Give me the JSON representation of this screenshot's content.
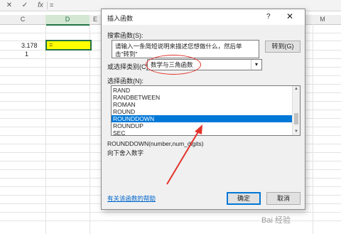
{
  "formula_bar": {
    "cancel": "✕",
    "confirm": "✓",
    "fx": "fx",
    "content": "="
  },
  "sheet": {
    "columns": [
      {
        "letter": "C",
        "selected": false
      },
      {
        "letter": "D",
        "selected": true
      },
      {
        "letter": "E",
        "selected": false
      },
      {
        "letter": "M",
        "selected": false
      }
    ],
    "cells": {
      "c_value": "3.178",
      "c_row2": "1",
      "active_cell": "="
    },
    "active_cell_color": "#ffff00",
    "accent_color": "#217346"
  },
  "dialog": {
    "title": "插入函数",
    "help_icon": "?",
    "close_icon": "✕",
    "search_label": "搜索函数(S):",
    "search_text": "请输入一条简短说明来描述您想做什么，然后单击\"转到\"",
    "goto_button": "转到(G)",
    "category_label": "或选择类别(C):",
    "category_value": "数学与三角函数",
    "function_list_label": "选择函数(N):",
    "functions": [
      "RAND",
      "RANDBETWEEN",
      "ROMAN",
      "ROUND",
      "ROUNDDOWN",
      "ROUNDUP",
      "SEC"
    ],
    "selected_function": "ROUNDDOWN",
    "signature": "ROUNDDOWN(number,num_digits)",
    "description": "向下舍入数字",
    "help_link": "有关该函数的帮助",
    "ok_button": "确定",
    "cancel_button": "取消",
    "selection_color": "#0078d7",
    "annotation_color": "#e3322b"
  },
  "watermark": "Bai 经验"
}
